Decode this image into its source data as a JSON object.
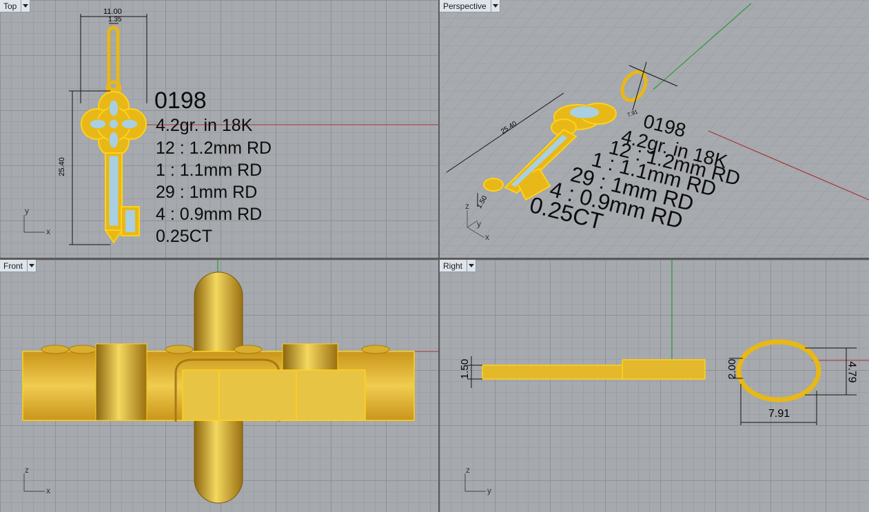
{
  "viewports": {
    "top": {
      "label": "Top"
    },
    "perspective": {
      "label": "Perspective"
    },
    "front": {
      "label": "Front"
    },
    "right": {
      "label": "Right"
    }
  },
  "info": {
    "code": "0198",
    "weight": "4.2gr.  in 18K",
    "stones": [
      "12 : 1.2mm RD",
      "1 : 1.1mm RD",
      "29 : 1mm RD",
      "4 : 0.9mm RD"
    ],
    "carat": "0.25CT"
  },
  "dimensions": {
    "top_width": "11.00",
    "top_bail": "1.35",
    "top_height": "25.40",
    "persp_length": "25.40",
    "persp_thick": "1.50",
    "persp_small": "7.91",
    "right_thick": "1.50",
    "right_bail": "2.00",
    "right_ring_h": "4.79",
    "right_ring_w": "7.91"
  },
  "axes": {
    "x": "x",
    "y": "y",
    "z": "z"
  },
  "colors": {
    "gold": "#e8b818",
    "gold_edge": "#ffd21a",
    "stone": "#a9cfe0",
    "grid": "#a6a9ad",
    "x_axis": "#a83434",
    "y_axis": "#2a9a3a"
  }
}
